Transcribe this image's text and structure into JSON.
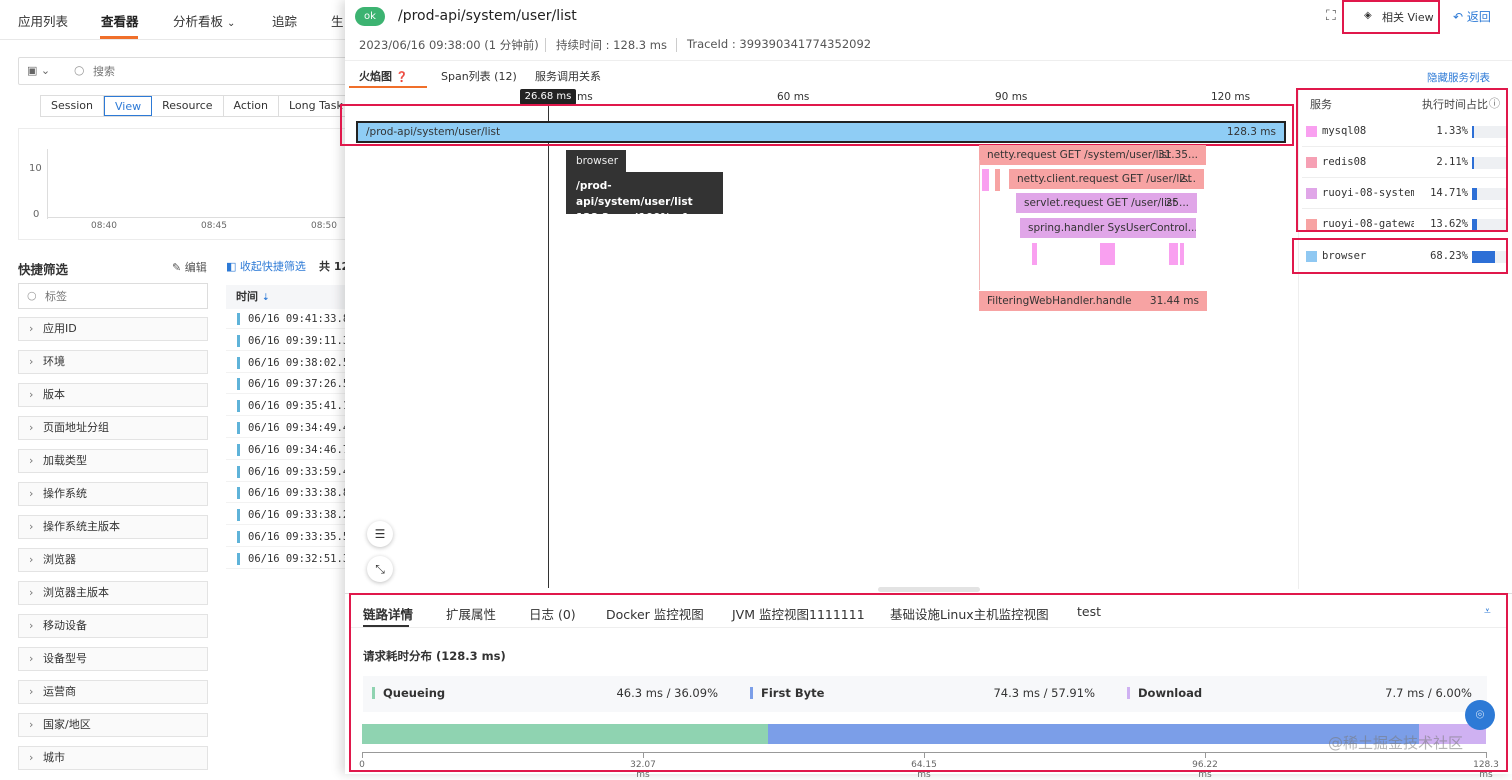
{
  "nav": {
    "items": [
      "应用列表",
      "查看器",
      "分析看板",
      "追踪",
      "生"
    ]
  },
  "search": {
    "placeholder": "搜索"
  },
  "view_tabs": [
    "Session",
    "View",
    "Resource",
    "Action",
    "Long Task"
  ],
  "mini_chart": {
    "y_ticks": [
      "10",
      "0"
    ],
    "x_ticks": [
      "08:40",
      "08:45",
      "08:50"
    ]
  },
  "quick_filter": {
    "title": "快捷筛选",
    "edit": "编辑",
    "collapse": "收起快捷筛选",
    "count_prefix": "共 12",
    "tag_placeholder": "标签",
    "items": [
      "应用ID",
      "环境",
      "版本",
      "页面地址分组",
      "加载类型",
      "操作系统",
      "操作系统主版本",
      "浏览器",
      "浏览器主版本",
      "移动设备",
      "设备型号",
      "运营商",
      "国家/地区",
      "城市"
    ]
  },
  "time_col": {
    "header": "时间",
    "rows": [
      "06/16 09:41:33.8",
      "06/16 09:39:11.3",
      "06/16 09:38:02.5",
      "06/16 09:37:26.5",
      "06/16 09:35:41.1",
      "06/16 09:34:49.4",
      "06/16 09:34:46.7",
      "06/16 09:33:59.4",
      "06/16 09:33:38.8",
      "06/16 09:33:38.2",
      "06/16 09:33:35.5",
      "06/16 09:32:51.3"
    ]
  },
  "detail": {
    "status": "ok",
    "title": "/prod-api/system/user/list",
    "time": "2023/06/16 09:38:00 (1 分钟前)",
    "duration": "持续时间 : 128.3 ms",
    "trace": "TraceId : 399390341774352092",
    "related": "相关 View",
    "back": "返回"
  },
  "tabs": {
    "flame": "火焰图",
    "span_list": "Span列表 (12)",
    "relation": "服务调用关系",
    "hide_list": "隐藏服务列表"
  },
  "axis": {
    "cursor": "26.68 ms",
    "ticks": [
      "ms",
      "60 ms",
      "90 ms",
      "120 ms"
    ]
  },
  "flame": {
    "root_name": "/prod-api/system/user/list",
    "root_dur": "128.3 ms",
    "tooltip_svc": "browser",
    "tooltip_name": "/prod-api/system/user/list",
    "tooltip_info": "128.3 ms (100% of total)",
    "bars": [
      {
        "name": "netty.request GET /system/user/list",
        "dur": "31.35..."
      },
      {
        "name": "netty.client.request GET /user/list",
        "dur": "2..."
      },
      {
        "name": "servlet.request GET /user/list",
        "dur": "25..."
      },
      {
        "name": "spring.handler SysUserControl...",
        "dur": ""
      },
      {
        "name": "FilteringWebHandler.handle",
        "dur": "31.44 ms"
      }
    ]
  },
  "services": {
    "header_name": "服务",
    "header_pct": "执行时间占比",
    "rows": [
      {
        "name": "mysql08",
        "pct": "1.33%",
        "val": 0.0133,
        "color": "#f9a0f0"
      },
      {
        "name": "redis08",
        "pct": "2.11%",
        "val": 0.0211,
        "color": "#f6a0b4"
      },
      {
        "name": "ruoyi-08-system",
        "pct": "14.71%",
        "val": 0.1471,
        "color": "#e0a6e8"
      },
      {
        "name": "ruoyi-08-gateway",
        "pct": "13.62%",
        "val": 0.1362,
        "color": "#f7a3a3"
      }
    ],
    "browser": {
      "name": "browser",
      "pct": "68.23%",
      "val": 0.6823,
      "color": "#8fc8f2"
    }
  },
  "bottom": {
    "tabs": [
      "链路详情",
      "扩展属性",
      "日志 (0)",
      "Docker 监控视图",
      "JVM 监控视图1111111",
      "基础设施Linux主机监控视图",
      "test"
    ],
    "section_title": "请求耗时分布 (128.3 ms)",
    "metrics": [
      {
        "name": "Queueing",
        "value": "46.3 ms",
        "pct": "36.09%",
        "frac": 0.3609,
        "color": "#8fd3b1"
      },
      {
        "name": "First Byte",
        "value": "74.3 ms",
        "pct": "57.91%",
        "frac": 0.5791,
        "color": "#7b9ee8"
      },
      {
        "name": "Download",
        "value": "7.7 ms",
        "pct": "6.00%",
        "frac": 0.06,
        "color": "#cfb1f2"
      }
    ],
    "axis_ticks": [
      "0",
      "32.07 ms",
      "64.15 ms",
      "96.22 ms",
      "128.3 ms"
    ]
  },
  "watermark": "@稀土掘金技术社区"
}
